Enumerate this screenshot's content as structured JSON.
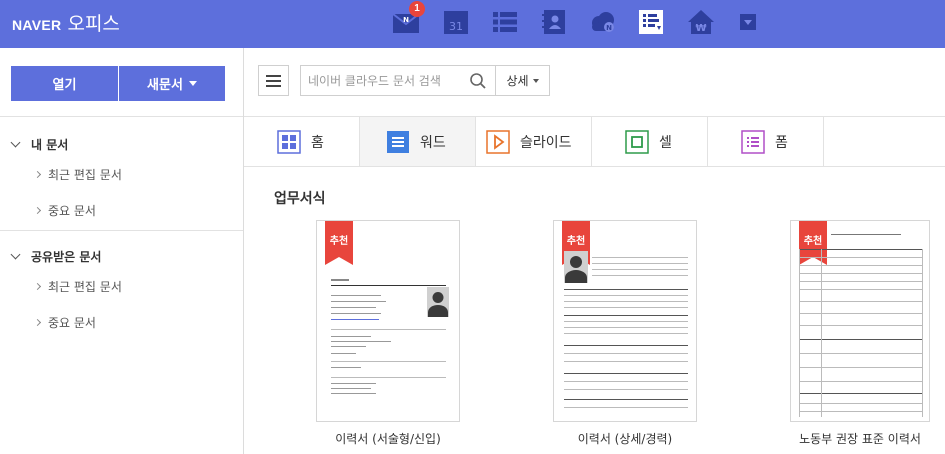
{
  "header": {
    "brand_naver": "NAVER",
    "brand_office": "오피스",
    "apps": [
      {
        "name": "mail-icon",
        "badge": "1"
      },
      {
        "name": "calendar-icon",
        "label": "31"
      },
      {
        "name": "list-icon"
      },
      {
        "name": "contacts-icon"
      },
      {
        "name": "cloud-icon",
        "label": "N"
      },
      {
        "name": "office-doc-icon"
      },
      {
        "name": "house-won-icon",
        "label": "₩"
      },
      {
        "name": "more-apps-icon"
      }
    ],
    "mail_badge": "1",
    "calendar_label": "31",
    "cloud_label": "N",
    "won_label": "₩"
  },
  "sidebar": {
    "open_label": "열기",
    "new_doc_label": "새문서",
    "my_docs": {
      "title": "내 문서",
      "items": [
        "최근 편집 문서",
        "중요 문서"
      ]
    },
    "shared_docs": {
      "title": "공유받은 문서",
      "items": [
        "최근 편집 문서",
        "중요 문서"
      ]
    }
  },
  "toolbar": {
    "search_placeholder": "네이버 클라우드 문서 검색",
    "detail_label": "상세"
  },
  "tabs": [
    {
      "label": "홈",
      "icon": "home-grid-icon",
      "color": "#5d6fdc"
    },
    {
      "label": "워드",
      "icon": "word-icon",
      "color": "#3f7fe0"
    },
    {
      "label": "슬라이드",
      "icon": "slide-icon",
      "color": "#e8742c"
    },
    {
      "label": "셀",
      "icon": "cell-icon",
      "color": "#2e9b4a"
    },
    {
      "label": "폼",
      "icon": "form-icon",
      "color": "#b04fc7"
    }
  ],
  "section_title": "업무서식",
  "templates": [
    {
      "caption": "이력서 (서술형/신입)",
      "ribbon": "추천"
    },
    {
      "caption": "이력서 (상세/경력)",
      "ribbon": "추천"
    },
    {
      "caption": "노동부 권장 표준 이력서",
      "ribbon": "추천"
    }
  ],
  "colors": {
    "brand": "#5d6fdc",
    "ribbon": "#e8453c"
  }
}
